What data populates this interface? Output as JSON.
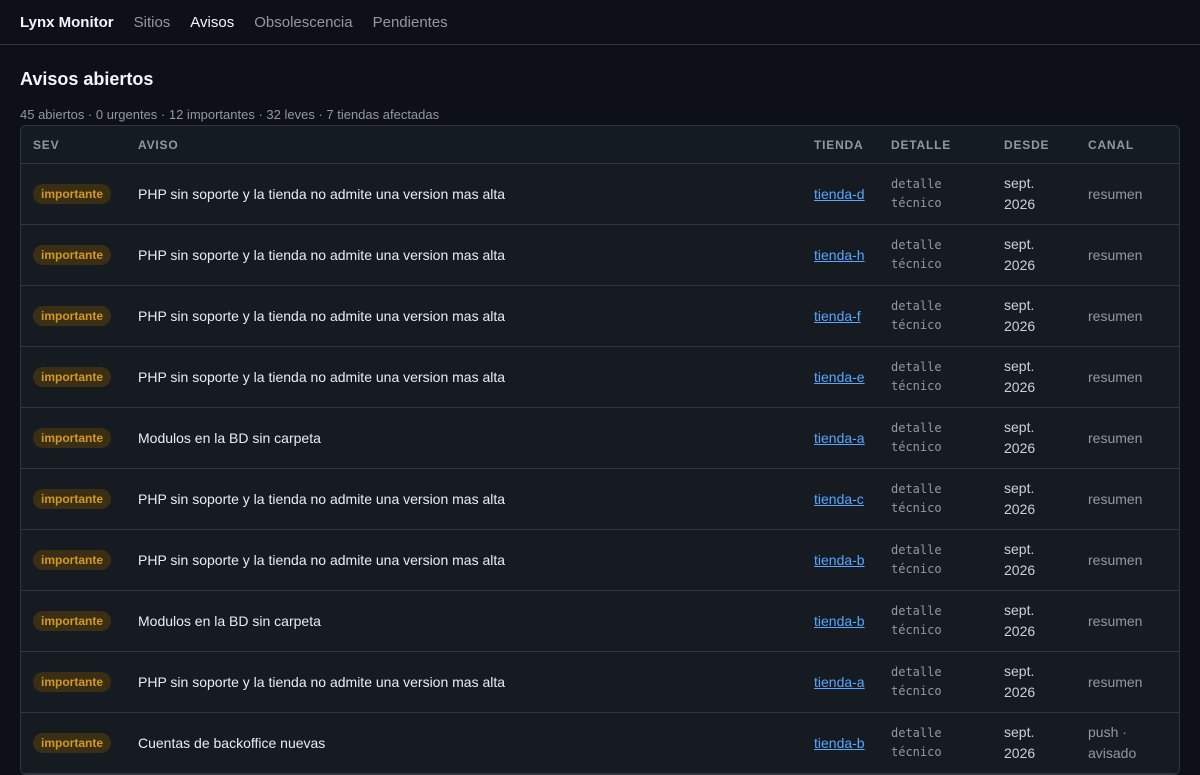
{
  "app": {
    "title": "Lynx Monitor"
  },
  "nav": [
    {
      "label": "Sitios",
      "active": false
    },
    {
      "label": "Avisos",
      "active": true
    },
    {
      "label": "Obsolescencia",
      "active": false
    },
    {
      "label": "Pendientes",
      "active": false
    }
  ],
  "page": {
    "title": "Avisos abiertos",
    "summary": "45 abiertos · 0 urgentes · 12 importantes · 32 leves · 7 tiendas afectadas"
  },
  "table": {
    "headers": {
      "sev": "SEV",
      "aviso": "AVISO",
      "tienda": "TIENDA",
      "detalle": "DETALLE",
      "desde": "DESDE",
      "canal": "CANAL"
    },
    "rows": [
      {
        "sev": "importante",
        "aviso": "PHP sin soporte y la tienda no admite una version mas alta",
        "tienda": "tienda-d",
        "detalle": "detalle técnico",
        "desde": "sept. 2026",
        "canal": "resumen"
      },
      {
        "sev": "importante",
        "aviso": "PHP sin soporte y la tienda no admite una version mas alta",
        "tienda": "tienda-h",
        "detalle": "detalle técnico",
        "desde": "sept. 2026",
        "canal": "resumen"
      },
      {
        "sev": "importante",
        "aviso": "PHP sin soporte y la tienda no admite una version mas alta",
        "tienda": "tienda-f",
        "detalle": "detalle técnico",
        "desde": "sept. 2026",
        "canal": "resumen"
      },
      {
        "sev": "importante",
        "aviso": "PHP sin soporte y la tienda no admite una version mas alta",
        "tienda": "tienda-e",
        "detalle": "detalle técnico",
        "desde": "sept. 2026",
        "canal": "resumen"
      },
      {
        "sev": "importante",
        "aviso": "Modulos en la BD sin carpeta",
        "tienda": "tienda-a",
        "detalle": "detalle técnico",
        "desde": "sept. 2026",
        "canal": "resumen"
      },
      {
        "sev": "importante",
        "aviso": "PHP sin soporte y la tienda no admite una version mas alta",
        "tienda": "tienda-c",
        "detalle": "detalle técnico",
        "desde": "sept. 2026",
        "canal": "resumen"
      },
      {
        "sev": "importante",
        "aviso": "PHP sin soporte y la tienda no admite una version mas alta",
        "tienda": "tienda-b",
        "detalle": "detalle técnico",
        "desde": "sept. 2026",
        "canal": "resumen"
      },
      {
        "sev": "importante",
        "aviso": "Modulos en la BD sin carpeta",
        "tienda": "tienda-b",
        "detalle": "detalle técnico",
        "desde": "sept. 2026",
        "canal": "resumen"
      },
      {
        "sev": "importante",
        "aviso": "PHP sin soporte y la tienda no admite una version mas alta",
        "tienda": "tienda-a",
        "detalle": "detalle técnico",
        "desde": "sept. 2026",
        "canal": "resumen"
      },
      {
        "sev": "importante",
        "aviso": "Cuentas de backoffice nuevas",
        "tienda": "tienda-b",
        "detalle": "detalle técnico",
        "desde": "sept. 2026",
        "canal": "push · avisado"
      }
    ]
  }
}
